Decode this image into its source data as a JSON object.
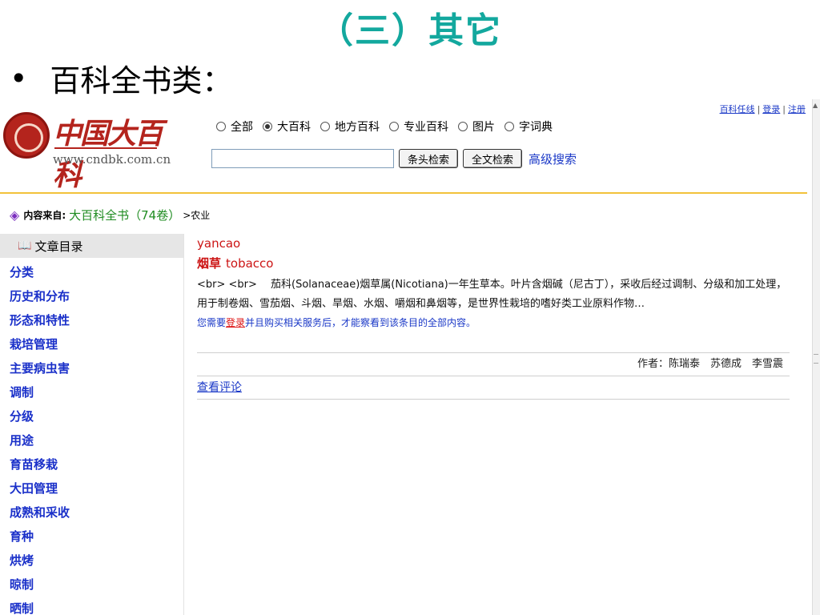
{
  "slide": {
    "title": "（三）其它",
    "bullet": "•",
    "bullet_text": "百科全书类："
  },
  "site": {
    "logo_name": "中国大百科",
    "logo_url": "www.cndbk.com.cn",
    "top_links": [
      "百科任线",
      "登录",
      "注册"
    ]
  },
  "search": {
    "options": [
      {
        "label": "全部",
        "checked": false
      },
      {
        "label": "大百科",
        "checked": true
      },
      {
        "label": "地方百科",
        "checked": false
      },
      {
        "label": "专业百科",
        "checked": false
      },
      {
        "label": "图片",
        "checked": false
      },
      {
        "label": "字词典",
        "checked": false
      }
    ],
    "input_value": "",
    "btn_title": "条头检索",
    "btn_fulltext": "全文检索",
    "advanced": "高级搜索"
  },
  "source": {
    "label": "内容来自:",
    "link": "大百科全书（74卷）",
    "crumb": ">农业"
  },
  "nav": {
    "heading": "文章目录",
    "items": [
      "分类",
      "历史和分布",
      "形态和特性",
      "栽培管理",
      "主要病虫害",
      "调制",
      "分级",
      "用途",
      "育苗移栽",
      "大田管理",
      "成熟和采收",
      "育种",
      "烘烤",
      "晾制",
      "晒制"
    ]
  },
  "article": {
    "pinyin": "yancao",
    "term_cn": "烟草",
    "term_en": "tobacco",
    "body": "<br> <br>　 茄科(Solanaceae)烟草属(Nicotiana)一年生草本。叶片含烟碱（尼古丁），采收后经过调制、分级和加工处理，用于制卷烟、雪茄烟、斗烟、旱烟、水烟、嚼烟和鼻烟等，是世界性栽培的嗜好类工业原料作物…",
    "note_before": "您需要",
    "note_login": "登录",
    "note_after": "并且购买相关服务后，才能察看到该条目的全部内容。",
    "author": "作者：陈瑞泰　苏德成　李雪震",
    "review": "查看评论"
  }
}
